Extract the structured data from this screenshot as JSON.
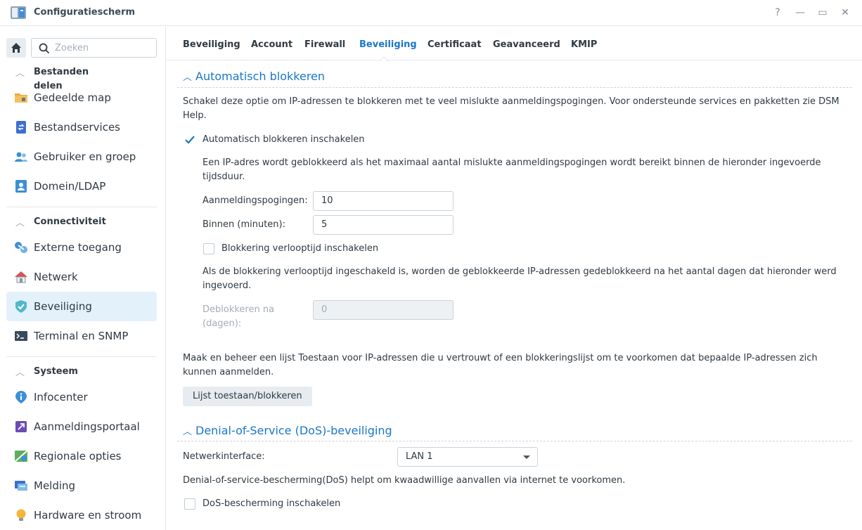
{
  "window": {
    "title": "Configuratiescherm",
    "help": "?",
    "minimize": "—",
    "maximize": "▭",
    "close": "✕"
  },
  "sidebar": {
    "search_placeholder": "Zoeken",
    "sections": [
      {
        "label": "Bestanden delen",
        "items": [
          "Gedeelde map",
          "Bestandservices",
          "Gebruiker en groep",
          "Domein/LDAP"
        ]
      },
      {
        "label": "Connectiviteit",
        "items": [
          "Externe toegang",
          "Netwerk",
          "Beveiliging",
          "Terminal en SNMP"
        ]
      },
      {
        "label": "Systeem",
        "items": [
          "Infocenter",
          "Aanmeldingsportaal",
          "Regionale opties",
          "Melding",
          "Hardware en stroom"
        ]
      }
    ],
    "active_item": "Beveiliging"
  },
  "tabs": [
    "Beveiliging",
    "Account",
    "Firewall",
    "Beveiliging",
    "Certificaat",
    "Geavanceerd",
    "KMIP"
  ],
  "active_tab_index": 3,
  "auto_block": {
    "title": "Automatisch blokkeren",
    "description": "Schakel deze optie om IP-adressen te blokkeren met te veel mislukte aanmeldingspogingen. Voor ondersteunde services en pakketten zie DSM Help.",
    "enable_label": "Automatisch blokkeren inschakelen",
    "enable_checked": true,
    "rule_text": "Een IP-adres wordt geblokkeerd als het maximaal aantal mislukte aanmeldingspogingen wordt bereikt binnen de hieronder ingevoerde tijdsduur.",
    "attempts_label": "Aanmeldingspogingen:",
    "attempts_value": "10",
    "within_label": "Binnen (minuten):",
    "within_value": "5",
    "expire_label": "Blokkering verlooptijd inschakelen",
    "expire_checked": false,
    "expire_text": "Als de blokkering verlooptijd ingeschakeld is, worden de geblokkeerde IP-adressen gedeblokkeerd na het aantal dagen dat hieronder werd ingevoerd.",
    "unblock_label": "Deblokkeren na (dagen):",
    "unblock_value": "0",
    "list_text": "Maak en beheer een lijst Toestaan voor IP-adressen die u vertrouwt of een blokkeringslijst om te voorkomen dat bepaalde IP-adressen zich kunnen aanmelden.",
    "list_button": "Lijst toestaan/blokkeren"
  },
  "dos": {
    "title": "Denial-of-Service (DoS)-beveiliging",
    "interface_label": "Netwerkinterface:",
    "interface_value": "LAN 1",
    "description": "Denial-of-service-bescherming(DoS) helpt om kwaadwillige aanvallen via internet te voorkomen.",
    "enable_label": "DoS-bescherming inschakelen",
    "enable_checked": false
  },
  "colors": {
    "accent": "#1a77c9",
    "active_bg": "#e3f1fb"
  }
}
